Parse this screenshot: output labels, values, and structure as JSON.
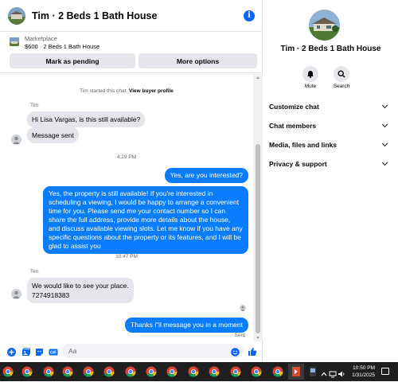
{
  "chat": {
    "title": "Tim · 2 Beds 1 Bath House",
    "marketplace": {
      "label": "Marketplace",
      "item": "$600 · 2 Beds 1 Bath House"
    },
    "buttons": {
      "pending": "Mark as pending",
      "options": "More options"
    },
    "system": {
      "started": "Tim started this chat.",
      "view_profile": "View buyer profile"
    },
    "messages": {
      "sender1": "Tim",
      "in1": "Hi Lisa Vargas, is this still available?",
      "in2": "Message sent",
      "time1": "4:29 PM",
      "out1": "Yes, are you interested?",
      "out2": "Yes, the property is still available! If you're interested in scheduling a viewing, I would be happy to arrange a convenient time for you. Please send me your contact number so I can share the full address, provide more details about the house, and discuss available viewing slots. Let me know if you have any specific questions about the property or its features, and I will be glad to assist you",
      "time2": "10:47 PM",
      "sender2": "Tim",
      "in3": "We would like to see your place.",
      "in4": "7274918383",
      "out3": "Thanks i\"il message you in a moment",
      "sent": "Sent"
    },
    "composer": {
      "placeholder": "Aa"
    }
  },
  "side": {
    "title": "Tim · 2 Beds 1 Bath House",
    "mute": "Mute",
    "search": "Search",
    "rows": [
      "Customize chat",
      "Chat members",
      "Media, files and links",
      "Privacy & support"
    ]
  },
  "taskbar": {
    "time": "10:50 PM",
    "date": "1/31/2025"
  },
  "colors": {
    "accent": "#0866ff",
    "bubble_out": "#0a7cff",
    "bubble_in": "#e4e6eb"
  }
}
